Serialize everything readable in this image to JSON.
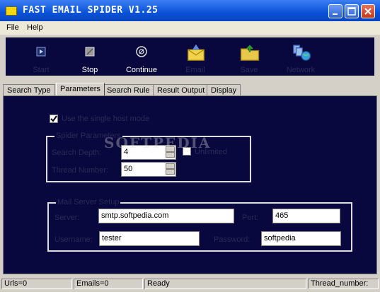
{
  "window": {
    "title": "FAST EMAIL SPIDER  V1.25"
  },
  "menu": {
    "items": [
      "File",
      "Help"
    ]
  },
  "toolbar": {
    "start_label": "Start",
    "stop_label": "Stop",
    "continue_label": "Continue",
    "email_label": "Email",
    "save_label": "Save",
    "network_label": "Network"
  },
  "tabs": [
    "Search Type",
    "Parameters",
    "Search Rule",
    "Result Output",
    "Display"
  ],
  "parameters": {
    "single_host_label": "Use the single host mode",
    "spider_group_title": "Spider Parameters",
    "search_depth_label": "Search Depth:",
    "search_depth_value": "4",
    "unlimited_label": "Unlimited",
    "thread_number_label": "Thread Number:",
    "thread_number_value": "50",
    "mail_group_title": "Mail Server Setup",
    "server_label": "Server:",
    "server_value": "smtp.softpedia.com",
    "port_label": "Port:",
    "port_value": "465",
    "username_label": "Username:",
    "username_value": "tester",
    "password_label": "Password:",
    "password_value": "softpedia"
  },
  "watermark": "SOFTPEDIA",
  "status": {
    "urls": "Urls=0",
    "emails": "Emails=0",
    "state": "Ready",
    "thread": "Thread_number:"
  },
  "colors": {
    "panel_bg": "#08083e",
    "titlebar": "#0a52d8"
  }
}
